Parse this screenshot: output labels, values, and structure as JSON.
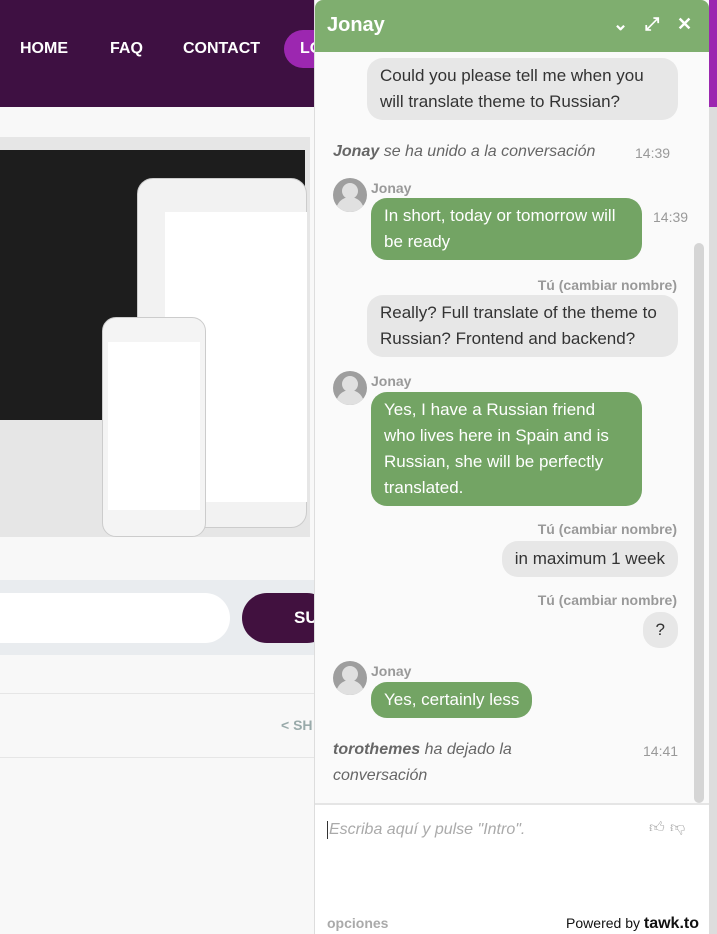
{
  "site": {
    "nav": [
      "HOME",
      "FAQ",
      "CONTACT"
    ],
    "login_partial": "LO",
    "subscribe_partial": "SU",
    "share_partial": "SH"
  },
  "chat": {
    "title": "Jonay",
    "messages": [
      {
        "from": "visitor",
        "text": "Could you please tell me when you will translate theme to Russian?"
      },
      {
        "system": "se ha unido a la conversación",
        "who": "Jonay",
        "time": "14:39"
      },
      {
        "from": "Jonay",
        "text": "In short, today or tomorrow will be ready",
        "time": "14:39"
      },
      {
        "from": "Tú (cambiar nombre)",
        "text": "Really? Full translate of the theme to Russian? Frontend and backend?"
      },
      {
        "from": "Jonay",
        "text": "Yes, I have a Russian friend who lives here in Spain and is Russian, she will be perfectly translated."
      },
      {
        "from": "Tú (cambiar nombre)",
        "text": "in maximum 1 week"
      },
      {
        "from": "Tú (cambiar nombre)",
        "text": "?"
      },
      {
        "from": "Jonay",
        "text": "Yes, certainly less"
      },
      {
        "system": "ha dejado la conversación",
        "who": "torothemes",
        "time": "14:41"
      }
    ],
    "placeholder": "Escriba aquí y pulse \"Intro\".",
    "options": "opciones",
    "powered": "Powered by",
    "brand": "tawk.to"
  }
}
